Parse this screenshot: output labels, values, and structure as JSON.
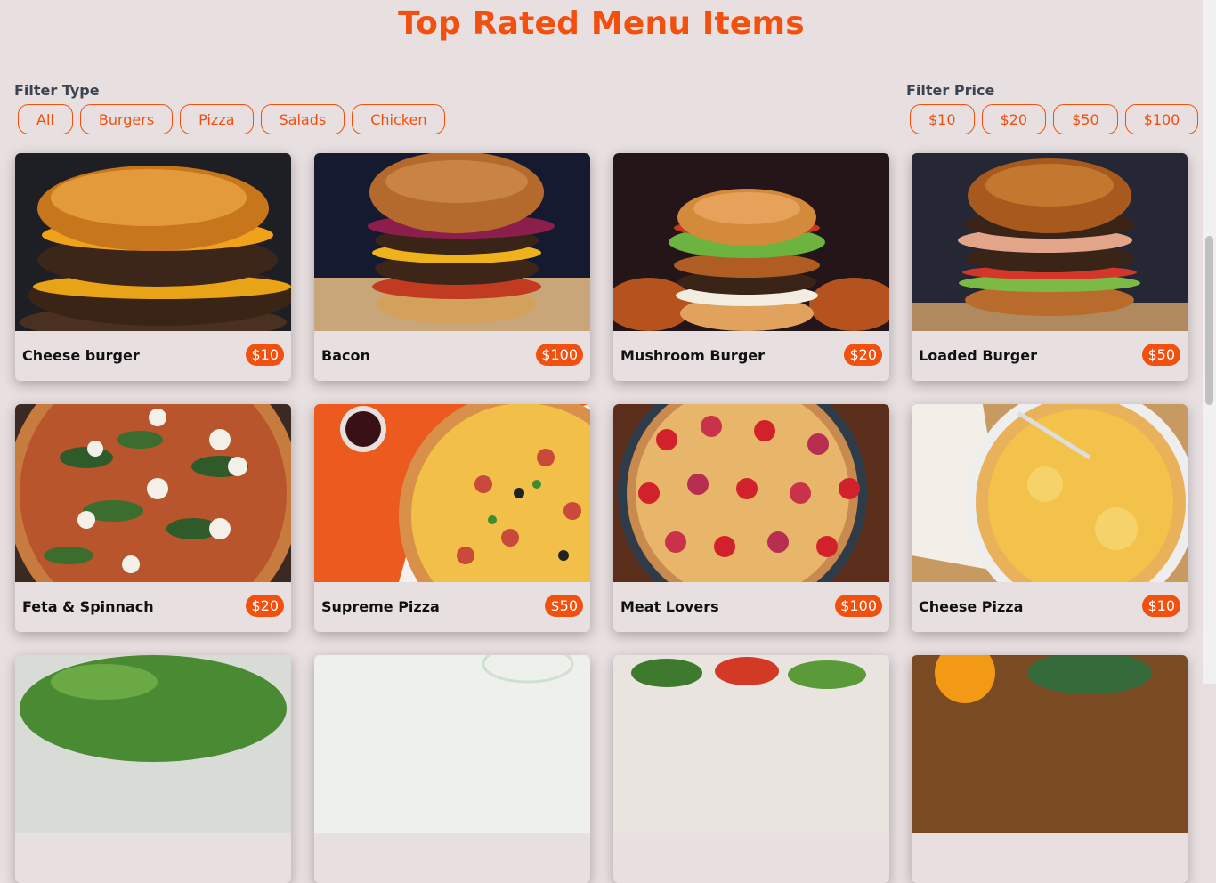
{
  "title": "Top Rated Menu Items",
  "filters": {
    "type_label": "Filter Type",
    "types": [
      "All",
      "Burgers",
      "Pizza",
      "Salads",
      "Chicken"
    ],
    "price_label": "Filter Price",
    "prices": [
      "$10",
      "$20",
      "$50",
      "$100"
    ]
  },
  "menu": [
    {
      "name": "Cheese burger",
      "price": "$10"
    },
    {
      "name": "Bacon",
      "price": "$100"
    },
    {
      "name": "Mushroom Burger",
      "price": "$20"
    },
    {
      "name": "Loaded Burger",
      "price": "$50"
    },
    {
      "name": "Feta & Spinnach",
      "price": "$20"
    },
    {
      "name": "Supreme Pizza",
      "price": "$50"
    },
    {
      "name": "Meat Lovers",
      "price": "$100"
    },
    {
      "name": "Cheese Pizza",
      "price": "$10"
    }
  ],
  "colors": {
    "accent": "#f2500f",
    "background": "#e8dfe0"
  }
}
